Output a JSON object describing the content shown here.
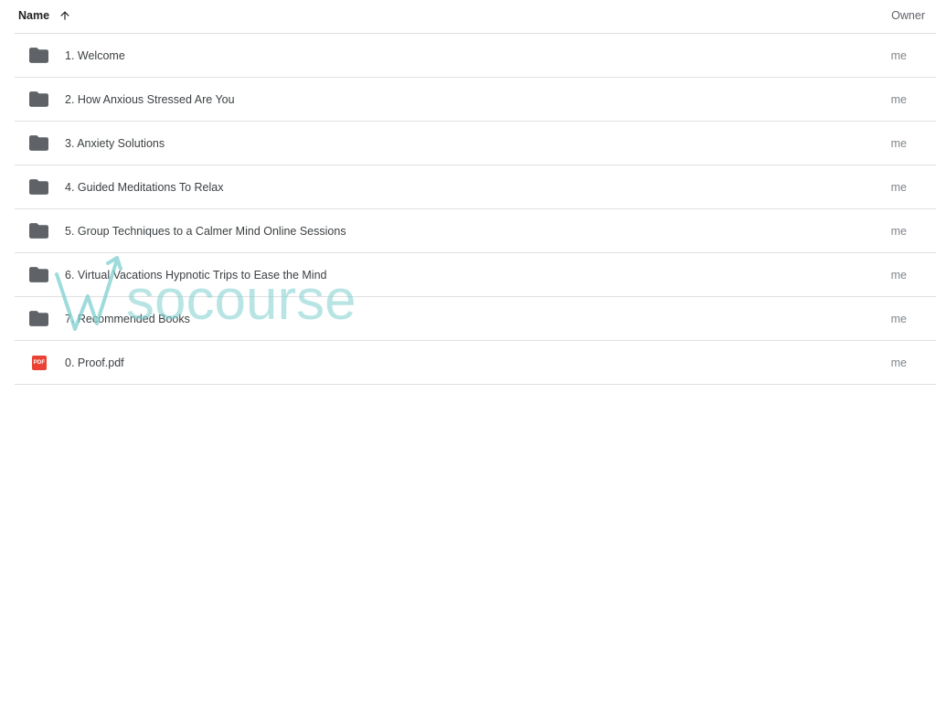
{
  "header": {
    "name_label": "Name",
    "owner_label": "Owner",
    "sort_icon": "arrow-up-icon"
  },
  "files": [
    {
      "name": "1. Welcome",
      "owner": "me",
      "type": "folder",
      "icon": "folder-icon"
    },
    {
      "name": "2. How Anxious Stressed Are You",
      "owner": "me",
      "type": "folder",
      "icon": "folder-icon"
    },
    {
      "name": "3. Anxiety Solutions",
      "owner": "me",
      "type": "folder",
      "icon": "folder-icon"
    },
    {
      "name": "4. Guided Meditations To Relax",
      "owner": "me",
      "type": "folder",
      "icon": "folder-icon"
    },
    {
      "name": "5. Group Techniques to a Calmer Mind Online Sessions",
      "owner": "me",
      "type": "folder",
      "icon": "folder-icon"
    },
    {
      "name": "6. Virtual Vacations Hypnotic Trips to Ease the Mind",
      "owner": "me",
      "type": "folder",
      "icon": "folder-icon"
    },
    {
      "name": "7. Recommended Books",
      "owner": "me",
      "type": "folder",
      "icon": "folder-icon"
    },
    {
      "name": "0. Proof.pdf",
      "owner": "me",
      "type": "pdf",
      "icon": "pdf-icon",
      "badge": "PDF"
    }
  ],
  "watermark": {
    "text": "socourse"
  },
  "colors": {
    "folder": "#5f6368",
    "pdf": "#ea4335",
    "divider": "#e0e0e0",
    "watermark": "#7fcfcf"
  }
}
